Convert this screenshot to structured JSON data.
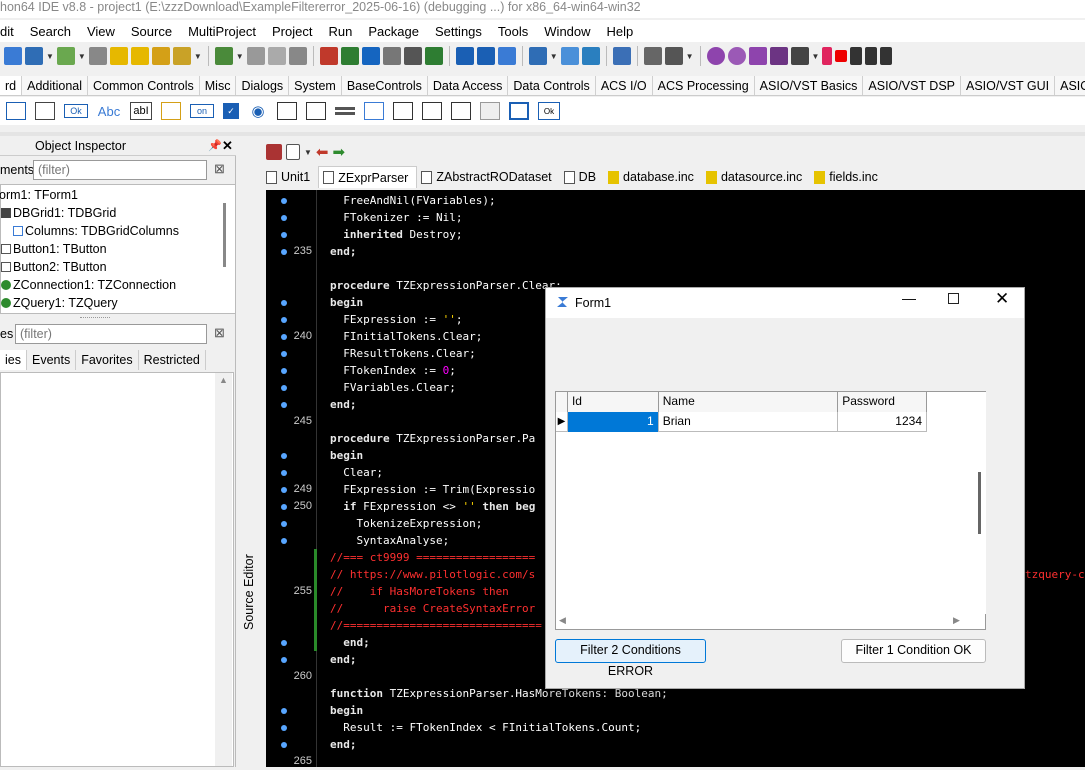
{
  "window": {
    "title": "hon64 IDE v8.8 - project1 (E:\\zzzDownload\\ExampleFiltererror_2025-06-16)  (debugging ...) for x86_64-win64-win32"
  },
  "menu": [
    "dit",
    "Search",
    "View",
    "Source",
    "MultiProject",
    "Project",
    "Run",
    "Package",
    "Settings",
    "Tools",
    "Window",
    "Help"
  ],
  "palette_tabs": [
    "rd",
    "Additional",
    "Common Controls",
    "Misc",
    "Dialogs",
    "System",
    "BaseControls",
    "Data Access",
    "Data Controls",
    "ACS I/O",
    "ACS Processing",
    "ASIO/VST Basics",
    "ASIO/VST DSP",
    "ASIO/VST GUI",
    "ASIO/VST GUI"
  ],
  "palette_items": {
    "ok": "Ok",
    "abc": "Abc",
    "abi": "abI",
    "on": "on"
  },
  "object_inspector": {
    "title": "Object Inspector",
    "components_label": "ments",
    "filter_placeholder": "(filter)",
    "tree": [
      "orm1: TForm1",
      "DBGrid1: TDBGrid",
      "Columns: TDBGridColumns",
      "Button1: TButton",
      "Button2: TButton",
      "ZConnection1: TZConnection",
      "ZQuery1: TZQuery"
    ],
    "props_label": "es",
    "tabs": [
      "ies",
      "Events",
      "Favorites",
      "Restricted"
    ]
  },
  "source_editor": {
    "side_label": "Source Editor",
    "tabs": [
      "Unit1",
      "ZExprParser",
      "ZAbstractRODataset",
      "DB",
      "database.inc",
      "datasource.inc",
      "fields.inc"
    ],
    "line_numbers": {
      "l235": "235",
      "l240": "240",
      "l245": "245",
      "l249": "249",
      "l250": "250",
      "l255": "255",
      "l260": "260",
      "l265": "265"
    },
    "code": {
      "c1": "  FreeAndNil(FVariables);",
      "c2": "  FTokenizer := Nil;",
      "c3a": "  inherited",
      "c3b": " Destroy;",
      "c4": "end;",
      "c6a": "procedure",
      "c6b": " TZExpressionParser.Clear;",
      "c7": "begin",
      "c8a": "  FExpression := ",
      "c8b": "''",
      "c8c": ";",
      "c9": "  FInitialTokens.Clear;",
      "c10": "  FResultTokens.Clear;",
      "c11a": "  FTokenIndex := ",
      "c11b": "0",
      "c11c": ";",
      "c12": "  FVariables.Clear;",
      "c13": "end;",
      "c15a": "procedure",
      "c15b": " TZExpressionParser.Pa",
      "c16": "begin",
      "c17": "  Clear;",
      "c18": "  FExpression := Trim(Expressio",
      "c19a": "  if",
      "c19b": " FExpression <> ",
      "c19c": "''",
      "c19d": " then",
      "c19e": " beg",
      "c20": "    TokenizeExpression;",
      "c21": "    SyntaxAnalyse;",
      "c22": "//=== ct9999 ==================",
      "c23": "// https://www.pilotlogic.com/s",
      "c23r": "tzquery-c",
      "c24": "//    if HasMoreTokens then",
      "c25": "//      raise CreateSyntaxError",
      "c26": "//==============================",
      "c27": "  end;",
      "c28": "end;",
      "c30a": "function",
      "c30b": " TZExpressionParser.HasMoreTokens: Boolean;",
      "c31": "begin",
      "c32": "  Result := FTokenIndex < FInitialTokens.Count;",
      "c33": "end;"
    }
  },
  "form1": {
    "title": "Form1",
    "grid": {
      "columns": [
        "Id",
        "Name",
        "Password"
      ],
      "rows": [
        [
          "1",
          "Brian",
          "1234"
        ]
      ]
    },
    "button1": "Filter 2 Conditions ERROR",
    "button2": "Filter 1 Condition OK"
  },
  "colors": {
    "editor_bg": "#000000",
    "comment": "#ff3030",
    "number": "#ff00ff",
    "selected_cell": "#0078d7"
  }
}
